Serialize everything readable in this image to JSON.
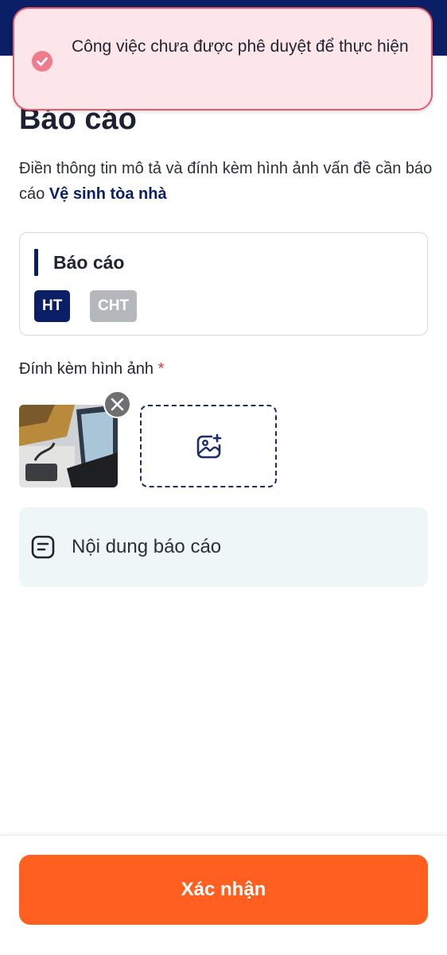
{
  "toast": {
    "message": "Công việc chưa được phê duyệt để thực hiện",
    "icon": "check-circle-icon",
    "background": "#fde6ea",
    "border_color": "#ea5a6a"
  },
  "page": {
    "title": "Báo cáo",
    "description_prefix": "Điền thông tin mô tả và đính kèm hình ảnh vấn đề cần báo cáo ",
    "description_highlight": "Vệ sinh tòa nhà"
  },
  "report_card": {
    "title": "Báo cáo",
    "options": [
      {
        "label": "HT",
        "selected": true
      },
      {
        "label": "CHT",
        "selected": false
      }
    ]
  },
  "attachments": {
    "label": "Đính kèm hình ảnh",
    "required_mark": "*",
    "images": [
      {
        "alt": "attached-photo-laptop"
      }
    ],
    "remove_icon": "close-icon",
    "add_icon": "add-image-icon"
  },
  "content": {
    "placeholder": "Nội dung báo cáo",
    "icon": "document-icon"
  },
  "footer": {
    "confirm_label": "Xác nhận"
  },
  "colors": {
    "primary": "#0b1f66",
    "accent": "#ff5f1f",
    "chip_inactive": "#b4b7bc",
    "content_bg": "#eef6f8"
  }
}
